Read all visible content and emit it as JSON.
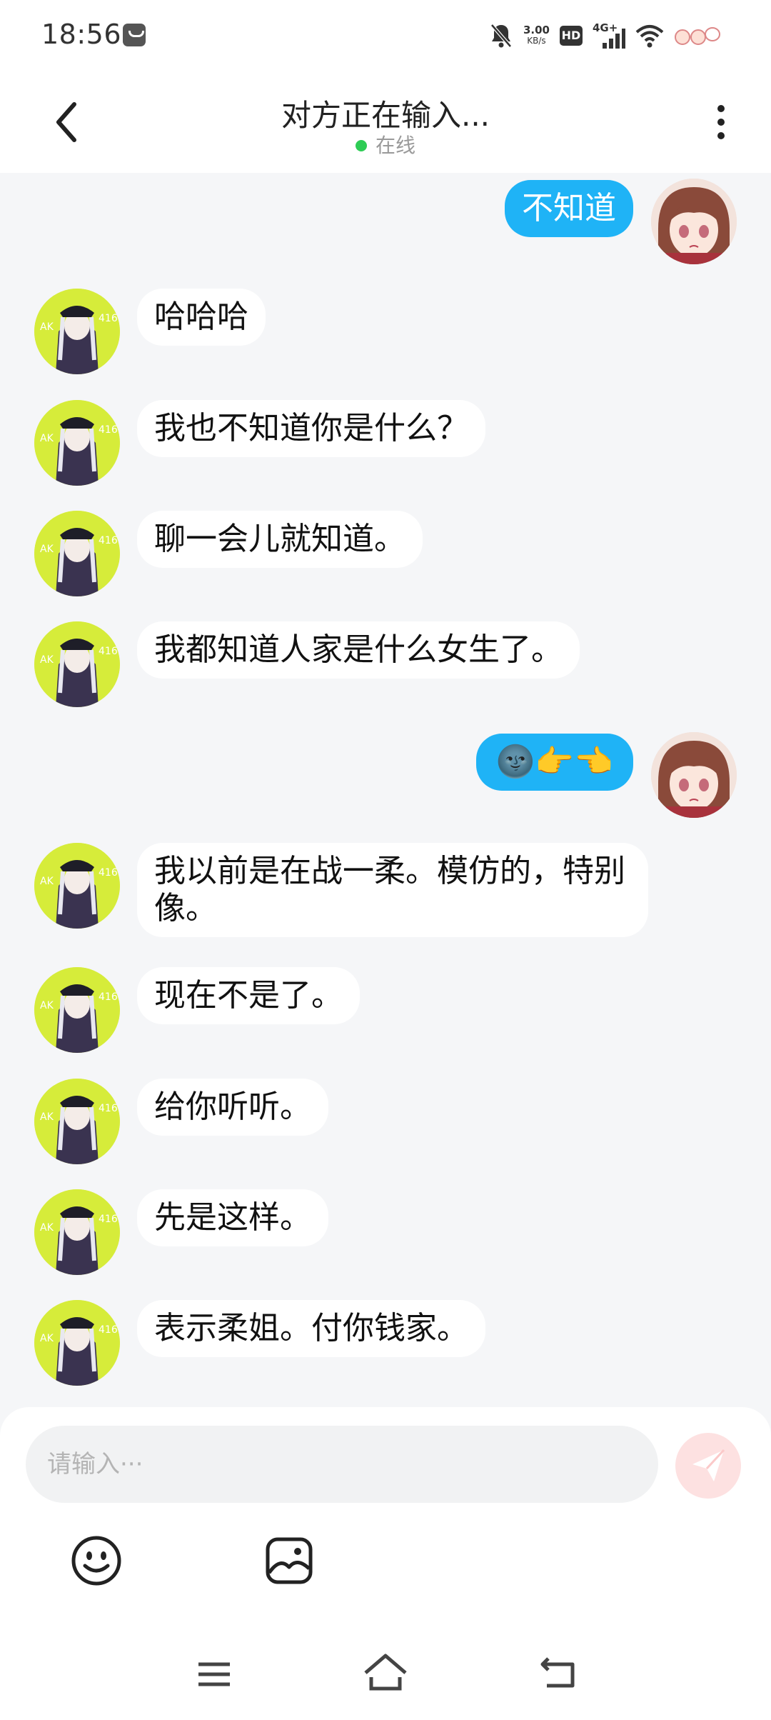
{
  "status_bar": {
    "time": "18:56",
    "net_speed_value": "3.00",
    "net_speed_unit": "KB/s",
    "hd_label": "HD",
    "network_label": "4G+"
  },
  "header": {
    "title": "对方正在输入...",
    "status": "在线",
    "status_color": "#2ecc55"
  },
  "messages": [
    {
      "sender": "self",
      "text": "不知道"
    },
    {
      "sender": "other",
      "text": "哈哈哈"
    },
    {
      "sender": "other",
      "text": "我也不知道你是什么？"
    },
    {
      "sender": "other",
      "text": "聊一会儿就知道。"
    },
    {
      "sender": "other",
      "text": "我都知道人家是什么女生了。"
    },
    {
      "sender": "self",
      "text": "🌚👉👈"
    },
    {
      "sender": "other",
      "text": "我以前是在战一柔。模仿的，特别像。"
    },
    {
      "sender": "other",
      "text": "现在不是了。"
    },
    {
      "sender": "other",
      "text": "给你听听。"
    },
    {
      "sender": "other",
      "text": "先是这样。"
    },
    {
      "sender": "other",
      "text": "表示柔姐。付你钱家。"
    }
  ],
  "composer": {
    "placeholder": "请输入···",
    "value": ""
  },
  "colors": {
    "self_bubble": "#1fb3f6",
    "other_bubble": "#ffffff",
    "background": "#f5f6f8",
    "send_button": "#fde1e1"
  },
  "icons": {
    "back": "chevron-left-icon",
    "more": "more-vertical-icon",
    "send": "paper-plane-icon",
    "emoji": "smiley-icon",
    "image": "image-icon",
    "nav_menu": "menu-icon",
    "nav_home": "home-icon",
    "nav_back": "back-icon"
  }
}
